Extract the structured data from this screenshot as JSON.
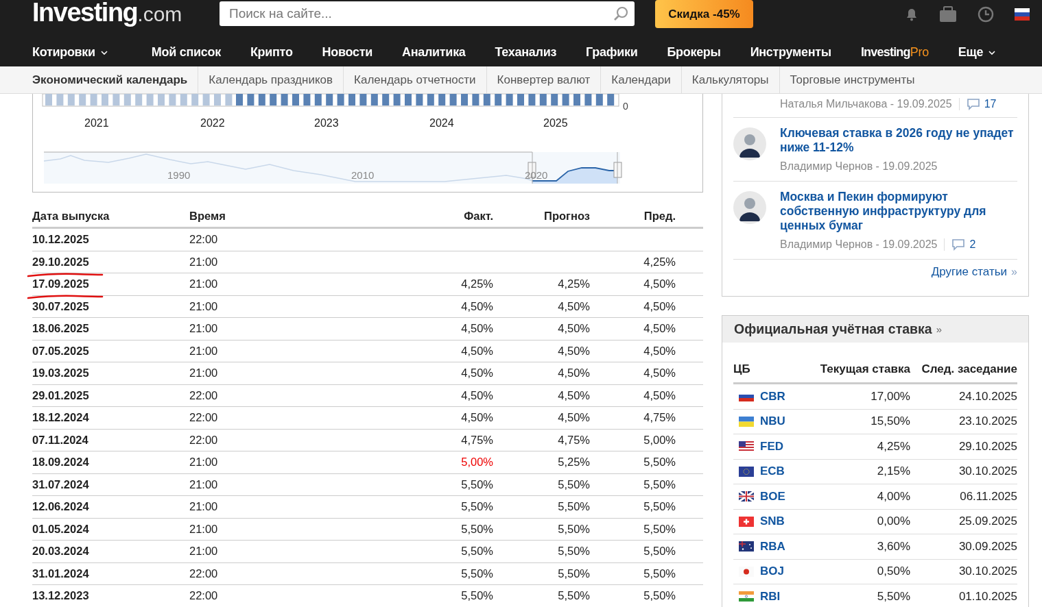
{
  "header": {
    "logo": {
      "name": "Investing",
      "suffix": ".com"
    },
    "search": {
      "placeholder": "Поиск на сайте..."
    },
    "promo": "Скидка -45%"
  },
  "nav": [
    {
      "kind": "dropdown",
      "label": "Котировки"
    },
    {
      "kind": "plain",
      "label": "Мой список"
    },
    {
      "kind": "plain",
      "label": "Крипто"
    },
    {
      "kind": "plain",
      "label": "Новости"
    },
    {
      "kind": "plain",
      "label": "Аналитика"
    },
    {
      "kind": "plain",
      "label": "Теханализ"
    },
    {
      "kind": "plain",
      "label": "Графики"
    },
    {
      "kind": "plain",
      "label": "Брокеры"
    },
    {
      "kind": "plain",
      "label": "Инструменты"
    },
    {
      "kind": "pro",
      "label": "Investing",
      "suffix": "Pro"
    },
    {
      "kind": "dropdown",
      "label": "Еще"
    }
  ],
  "subnav": [
    {
      "label": "Экономический календарь",
      "selected": true
    },
    {
      "label": "Календарь праздников",
      "selected": false
    },
    {
      "label": "Календарь отчетности",
      "selected": false
    },
    {
      "label": "Конвертер валют",
      "selected": false
    },
    {
      "label": "Календари",
      "selected": false
    },
    {
      "label": "Калькуляторы",
      "selected": false
    },
    {
      "label": "Торговые инструменты",
      "selected": false
    }
  ],
  "chart": {
    "y_tick": "0",
    "years": [
      "2021",
      "2022",
      "2023",
      "2024",
      "2025"
    ],
    "navigator_years": [
      "1990",
      "2010",
      "2020"
    ]
  },
  "table": {
    "columns": [
      "Дата выпуска",
      "Время",
      "Факт.",
      "Прогноз",
      "Пред."
    ],
    "rows": [
      {
        "date": "10.12.2025",
        "time": "22:00",
        "underlined": false
      },
      {
        "date": "29.10.2025",
        "time": "21:00",
        "previous": "4,25%",
        "underlined": true
      },
      {
        "date": "17.09.2025",
        "time": "21:00",
        "actual": "4,25%",
        "actual_negative": false,
        "forecast": "4,25%",
        "previous": "4,50%",
        "underlined": true
      },
      {
        "date": "30.07.2025",
        "time": "21:00",
        "actual": "4,50%",
        "actual_negative": false,
        "forecast": "4,50%",
        "previous": "4,50%",
        "underlined": false
      },
      {
        "date": "18.06.2025",
        "time": "21:00",
        "actual": "4,50%",
        "actual_negative": false,
        "forecast": "4,50%",
        "previous": "4,50%",
        "underlined": false
      },
      {
        "date": "07.05.2025",
        "time": "21:00",
        "actual": "4,50%",
        "actual_negative": false,
        "forecast": "4,50%",
        "previous": "4,50%",
        "underlined": false
      },
      {
        "date": "19.03.2025",
        "time": "21:00",
        "actual": "4,50%",
        "actual_negative": false,
        "forecast": "4,50%",
        "previous": "4,50%",
        "underlined": false
      },
      {
        "date": "29.01.2025",
        "time": "22:00",
        "actual": "4,50%",
        "actual_negative": false,
        "forecast": "4,50%",
        "previous": "4,50%",
        "underlined": false
      },
      {
        "date": "18.12.2024",
        "time": "22:00",
        "actual": "4,50%",
        "actual_negative": false,
        "forecast": "4,50%",
        "previous": "4,75%",
        "underlined": false
      },
      {
        "date": "07.11.2024",
        "time": "22:00",
        "actual": "4,75%",
        "actual_negative": false,
        "forecast": "4,75%",
        "previous": "5,00%",
        "underlined": false
      },
      {
        "date": "18.09.2024",
        "time": "21:00",
        "actual": "5,00%",
        "actual_negative": true,
        "forecast": "5,25%",
        "previous": "5,50%",
        "underlined": false
      },
      {
        "date": "31.07.2024",
        "time": "21:00",
        "actual": "5,50%",
        "actual_negative": false,
        "forecast": "5,50%",
        "previous": "5,50%",
        "underlined": false
      },
      {
        "date": "12.06.2024",
        "time": "21:00",
        "actual": "5,50%",
        "actual_negative": false,
        "forecast": "5,50%",
        "previous": "5,50%",
        "underlined": false
      },
      {
        "date": "01.05.2024",
        "time": "21:00",
        "actual": "5,50%",
        "actual_negative": false,
        "forecast": "5,50%",
        "previous": "5,50%",
        "underlined": false
      },
      {
        "date": "20.03.2024",
        "time": "21:00",
        "actual": "5,50%",
        "actual_negative": false,
        "forecast": "5,50%",
        "previous": "5,50%",
        "underlined": false
      },
      {
        "date": "31.01.2024",
        "time": "22:00",
        "actual": "5,50%",
        "actual_negative": false,
        "forecast": "5,50%",
        "previous": "5,50%",
        "underlined": false
      },
      {
        "date": "13.12.2023",
        "time": "22:00",
        "actual": "5,50%",
        "actual_negative": false,
        "forecast": "5,50%",
        "previous": "5,50%",
        "underlined": false
      }
    ]
  },
  "articles": {
    "items": [
      {
        "author": "Наталья Мильчакова - 19.09.2025",
        "comments": "17"
      },
      {
        "title": "Ключевая ставка в 2026 году не упадет ниже 11-12%",
        "author": "Владимир Чернов - 19.09.2025"
      },
      {
        "title": "Москва и Пекин формируют собственную инфраструктуру для ценных бумаг",
        "author": "Владимир Чернов - 19.09.2025",
        "comments": "2"
      }
    ],
    "more": "Другие статьи",
    "more_arrow": "»"
  },
  "rates": {
    "title": "Официальная учётная ставка",
    "title_arrow": "»",
    "columns": [
      "ЦБ",
      "Текущая ставка",
      "След. заседание"
    ],
    "rows": [
      {
        "bank": "CBR",
        "rate": "17,00%",
        "next": "24.10.2025"
      },
      {
        "bank": "NBU",
        "rate": "15,50%",
        "next": "23.10.2025"
      },
      {
        "bank": "FED",
        "rate": "4,25%",
        "next": "29.10.2025"
      },
      {
        "bank": "ECB",
        "rate": "2,15%",
        "next": "30.10.2025"
      },
      {
        "bank": "BOE",
        "rate": "4,00%",
        "next": "06.11.2025"
      },
      {
        "bank": "SNB",
        "rate": "0,00%",
        "next": "25.09.2025"
      },
      {
        "bank": "RBA",
        "rate": "3,60%",
        "next": "30.09.2025"
      },
      {
        "bank": "BOJ",
        "rate": "0,50%",
        "next": "30.10.2025"
      },
      {
        "bank": "RBI",
        "rate": "5,50%",
        "next": "01.10.2025"
      }
    ]
  }
}
